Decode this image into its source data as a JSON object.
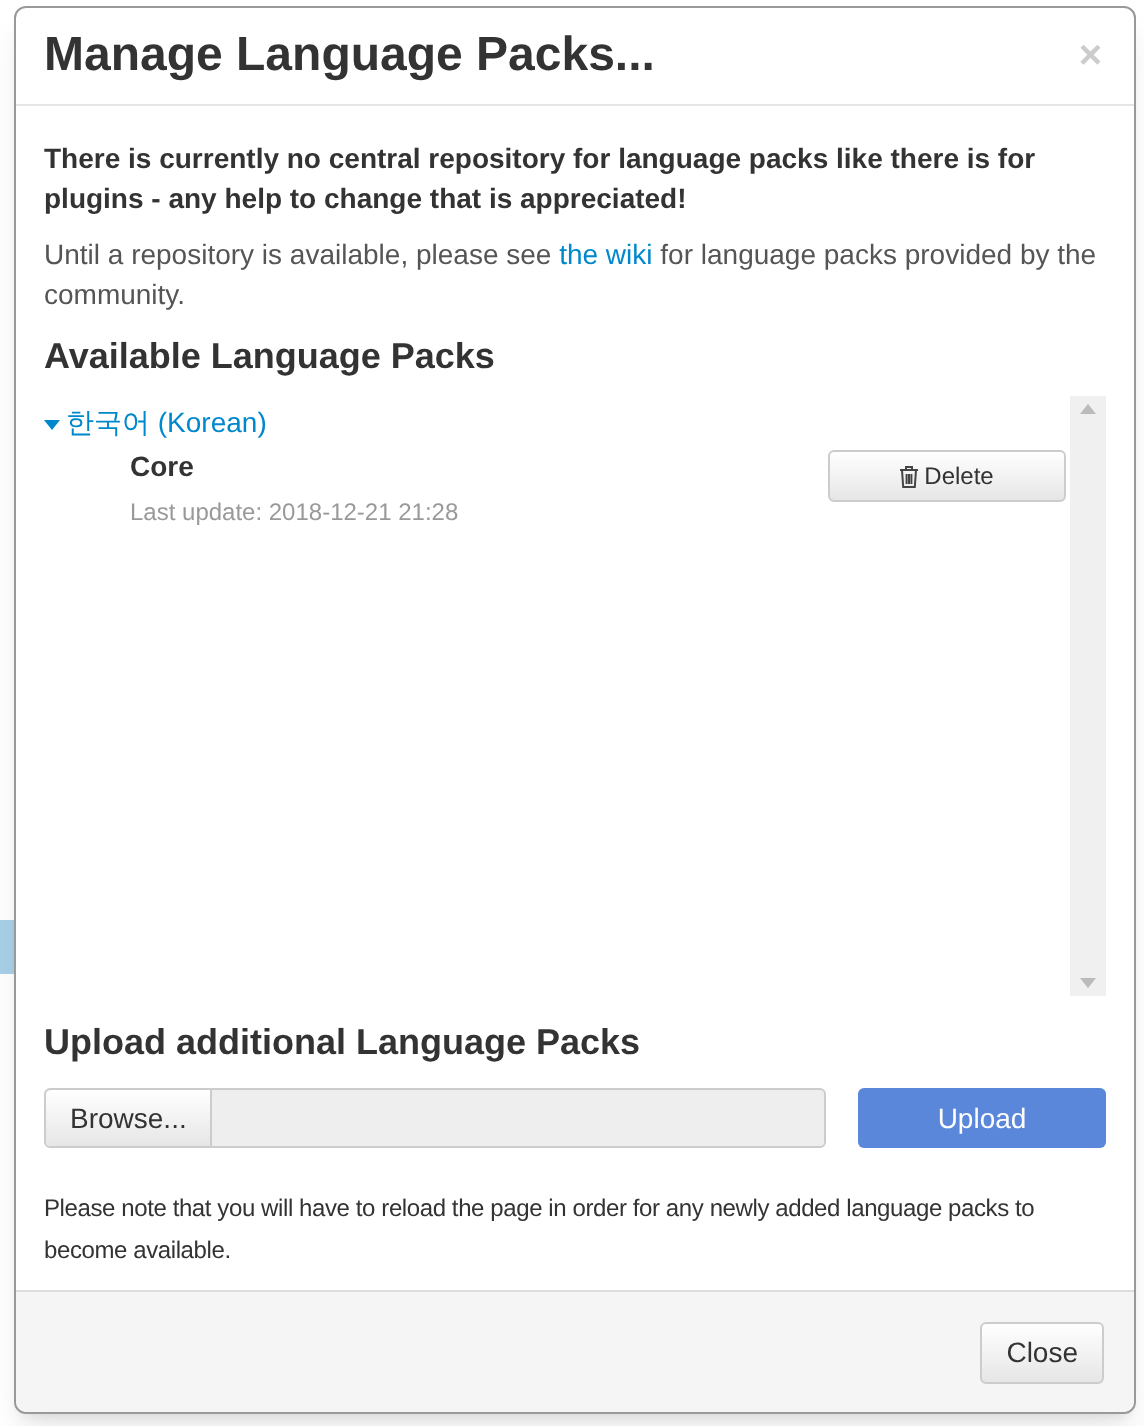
{
  "dialog": {
    "title": "Manage Language Packs...",
    "close": "×"
  },
  "notice": "There is currently no central repository for language packs like there is for plugins - any help to change that is appreciated!",
  "intro": {
    "before": "Until a repository is available, please see ",
    "link": "the wiki",
    "after": " for language packs provided by the community."
  },
  "available": {
    "heading": "Available Language Packs",
    "languages": [
      {
        "name": "한국어 (Korean)",
        "expanded": true,
        "children": [
          {
            "name": "Core",
            "last_update": "Last update: 2018-12-21 21:28",
            "action": "Delete"
          }
        ]
      }
    ]
  },
  "upload": {
    "heading": "Upload additional Language Packs",
    "browse": "Browse...",
    "button": "Upload",
    "note": "Please note that you will have to reload the page in order for any newly added language packs to become available."
  },
  "footer": {
    "button": "Close"
  }
}
